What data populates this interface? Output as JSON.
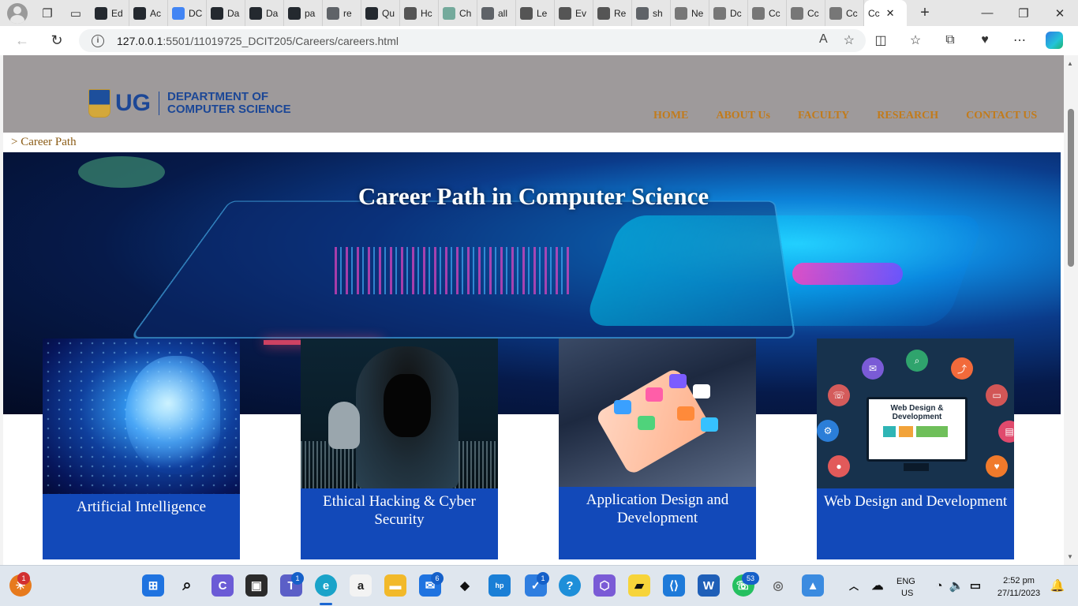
{
  "browser": {
    "tabs": [
      {
        "label": "Ed",
        "icon": "github-icon",
        "color": "#24292f"
      },
      {
        "label": "Ac",
        "icon": "github-icon",
        "color": "#24292f"
      },
      {
        "label": "DC",
        "icon": "docs-icon",
        "color": "#4285f4"
      },
      {
        "label": "Da",
        "icon": "github-icon",
        "color": "#24292f"
      },
      {
        "label": "Da",
        "icon": "github-icon",
        "color": "#24292f"
      },
      {
        "label": "pa",
        "icon": "github-icon",
        "color": "#24292f"
      },
      {
        "label": "re",
        "icon": "search-icon",
        "color": "#5f6368"
      },
      {
        "label": "Qu",
        "icon": "github-icon",
        "color": "#24292f"
      },
      {
        "label": "Hc",
        "icon": "site-icon",
        "color": "#555555"
      },
      {
        "label": "Ch",
        "icon": "chatgpt-icon",
        "color": "#74aa9c"
      },
      {
        "label": "all",
        "icon": "search-icon",
        "color": "#5f6368"
      },
      {
        "label": "Le",
        "icon": "site-icon",
        "color": "#555555"
      },
      {
        "label": "Ev",
        "icon": "site-icon",
        "color": "#555555"
      },
      {
        "label": "Re",
        "icon": "site-icon",
        "color": "#555555"
      },
      {
        "label": "sh",
        "icon": "search-icon",
        "color": "#5f6368"
      },
      {
        "label": "Ne",
        "icon": "page-icon",
        "color": "#777777"
      },
      {
        "label": "Dc",
        "icon": "page-icon",
        "color": "#777777"
      },
      {
        "label": "Cc",
        "icon": "page-icon",
        "color": "#777777"
      },
      {
        "label": "Cc",
        "icon": "page-icon",
        "color": "#777777"
      },
      {
        "label": "Cc",
        "icon": "page-icon",
        "color": "#777777"
      }
    ],
    "active_tab": {
      "label": "Cc"
    },
    "url_host": "127.0.0.1",
    "url_path": ":5501/11019725_DCIT205/Careers/careers.html"
  },
  "site": {
    "logo": {
      "ug": "UG",
      "dept_line1": "DEPARTMENT OF",
      "dept_line2": "COMPUTER SCIENCE"
    },
    "nav": [
      "HOME",
      "ABOUT Us",
      "FACULTY",
      "RESEARCH",
      "CONTACT US"
    ],
    "breadcrumb": "> Career Path",
    "hero_title": "Career Path in Computer Science",
    "cards": [
      {
        "title": "Artificial Intelligence"
      },
      {
        "title": "Ethical Hacking & Cyber Security"
      },
      {
        "title": "Application Design and Development"
      },
      {
        "title": "Web Design and Development",
        "image_text": "Web Design & Development"
      }
    ],
    "colors": {
      "header": "#9e9a9b",
      "nav": "#c27b1b",
      "card": "#1249b9",
      "brand": "#1c4796"
    }
  },
  "taskbar": {
    "badges": {
      "notify": "1",
      "teams": "1",
      "mail": "6",
      "todo": "1",
      "whatsapp": "53"
    },
    "lang": "ENG",
    "region": "US",
    "time": "2:52 pm",
    "date": "27/11/2023"
  }
}
